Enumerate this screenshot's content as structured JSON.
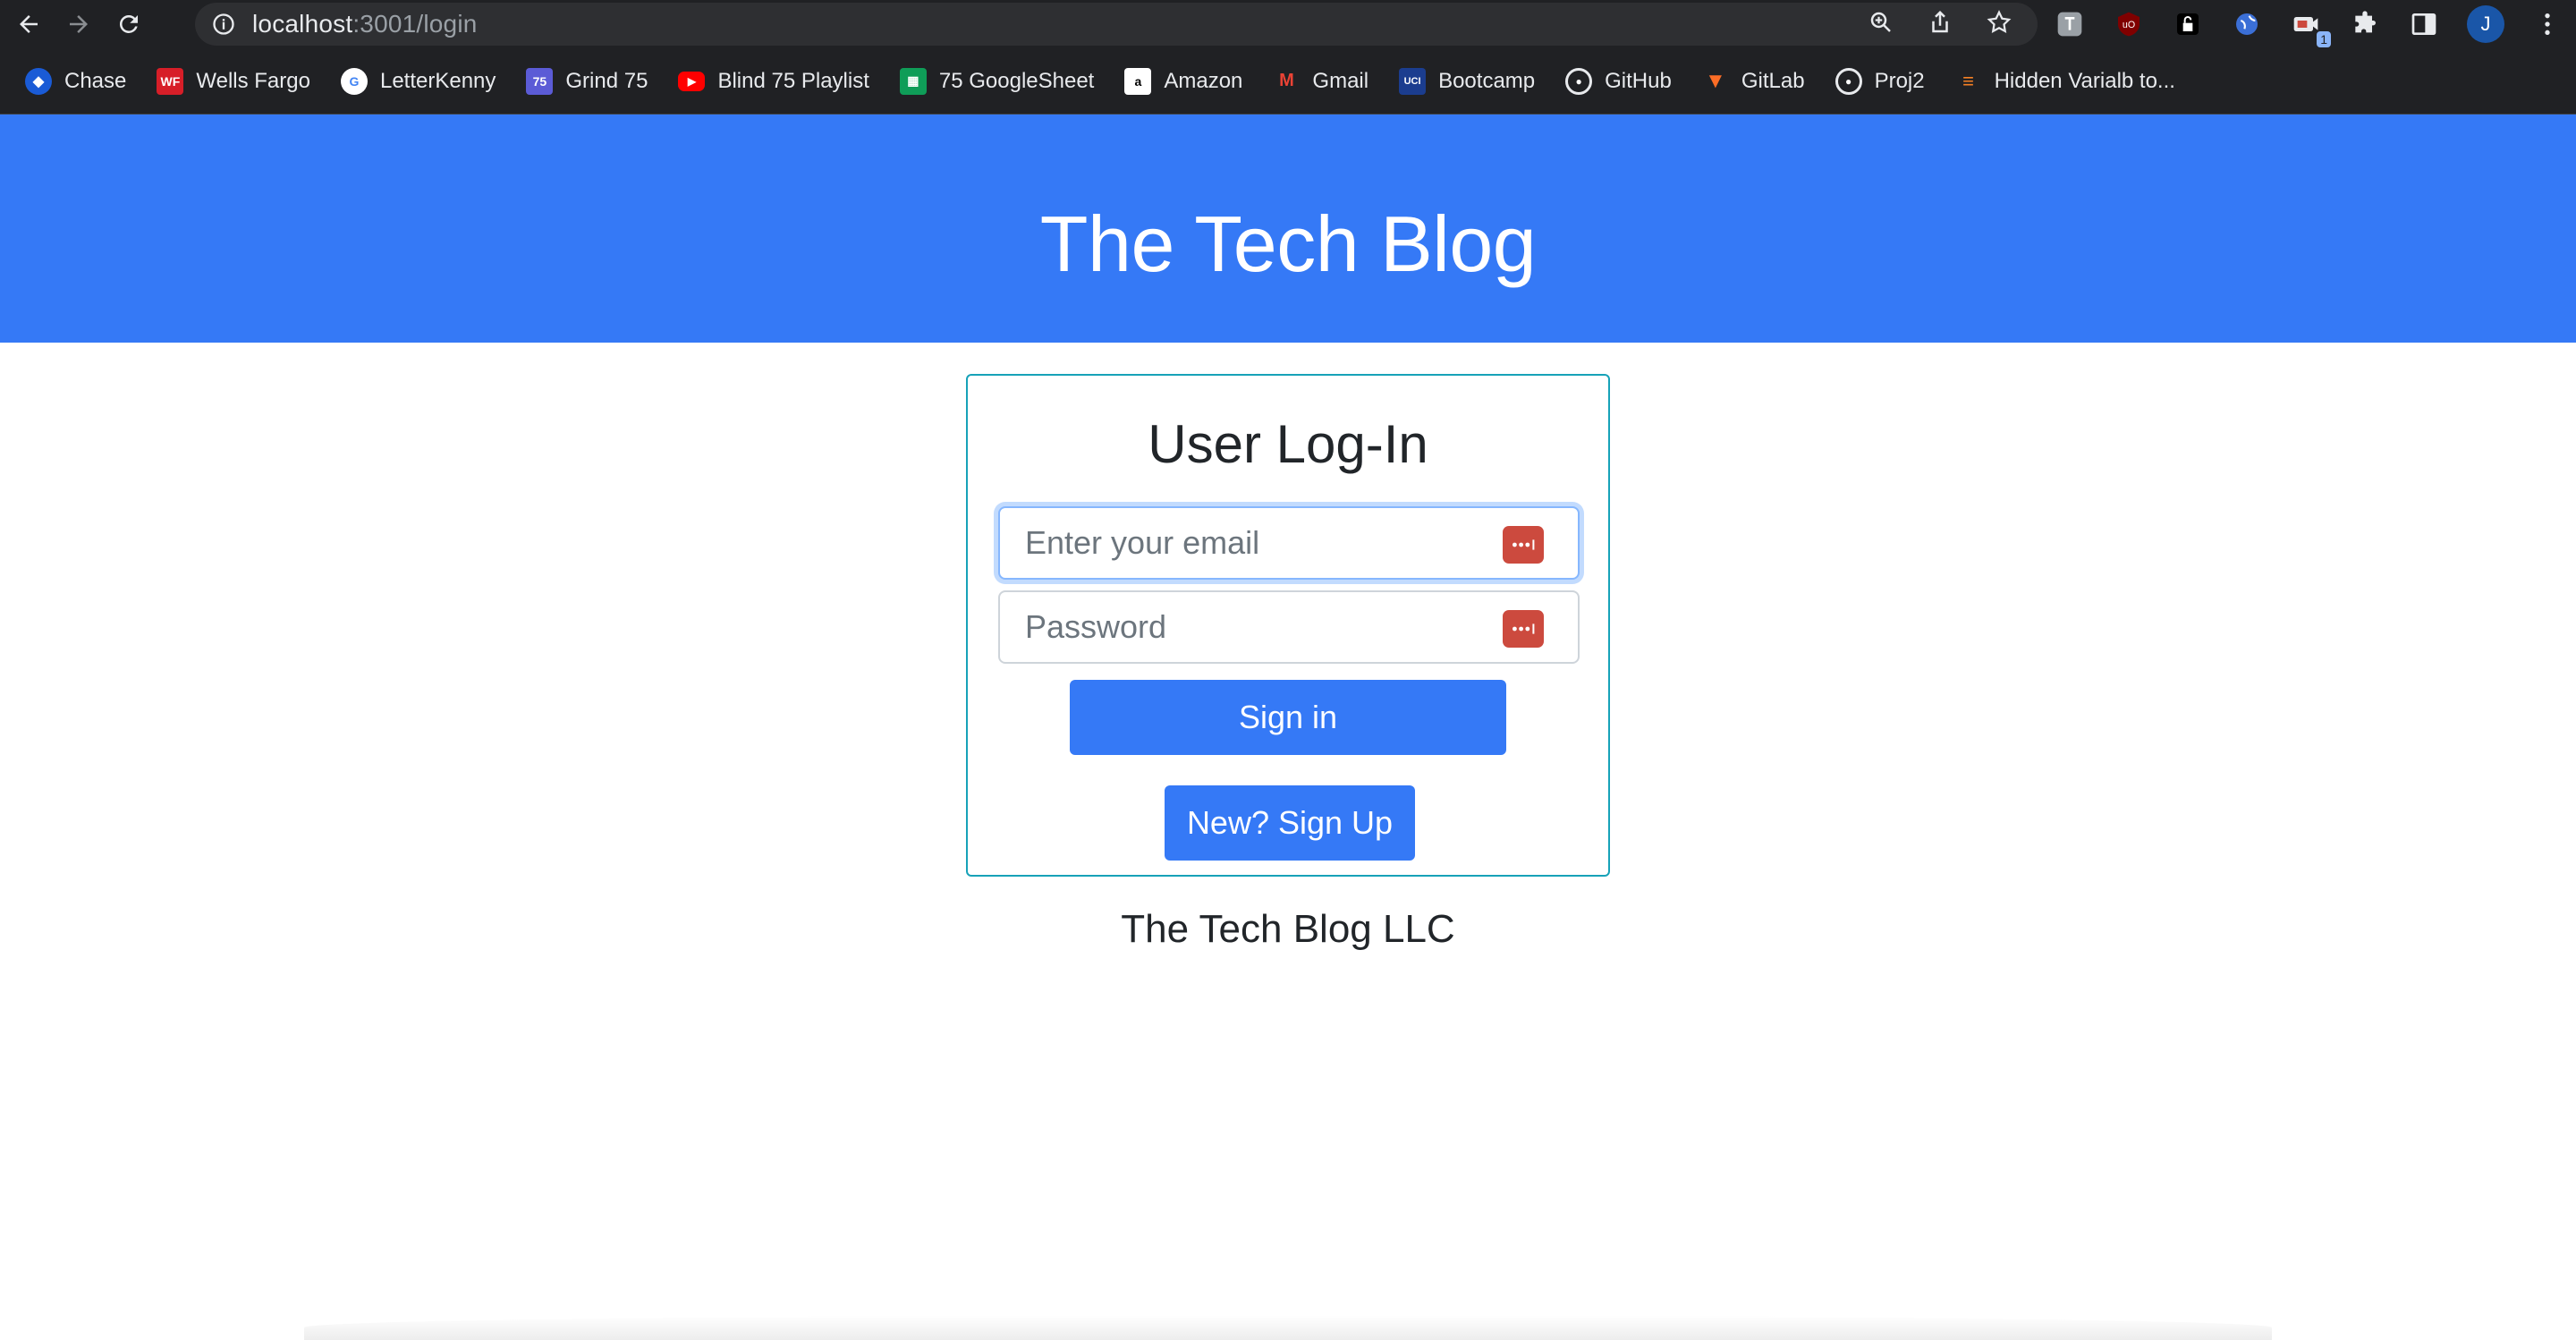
{
  "browser": {
    "url_host": "localhost",
    "url_path": ":3001/login",
    "profile_initial": "J",
    "extension_badge": "1"
  },
  "bookmarks": [
    {
      "label": "Chase",
      "icon": "chase-icon",
      "color": "#1a5bd6"
    },
    {
      "label": "Wells Fargo",
      "icon": "wells-fargo-icon",
      "color": "#d71e28"
    },
    {
      "label": "LetterKenny",
      "icon": "google-icon",
      "color": "#ffffff"
    },
    {
      "label": "Grind 75",
      "icon": "grind75-icon",
      "color": "#5b5bd6"
    },
    {
      "label": "Blind 75 Playlist",
      "icon": "youtube-icon",
      "color": "#ff0000"
    },
    {
      "label": "75 GoogleSheet",
      "icon": "sheets-icon",
      "color": "#0f9d58"
    },
    {
      "label": "Amazon",
      "icon": "amazon-icon",
      "color": "#ffffff"
    },
    {
      "label": "Gmail",
      "icon": "gmail-icon",
      "color": "#ea4335"
    },
    {
      "label": "Bootcamp",
      "icon": "uci-icon",
      "color": "#1b3d8f"
    },
    {
      "label": "GitHub",
      "icon": "github-icon",
      "color": "#ffffff"
    },
    {
      "label": "GitLab",
      "icon": "gitlab-icon",
      "color": "#fc6d26"
    },
    {
      "label": "Proj2",
      "icon": "github-icon",
      "color": "#ffffff"
    },
    {
      "label": "Hidden Varialb to...",
      "icon": "stackoverflow-icon",
      "color": "#f48024"
    }
  ],
  "header": {
    "title": "The Tech Blog"
  },
  "login": {
    "heading": "User Log-In",
    "email_placeholder": "Enter your email",
    "password_placeholder": "Password",
    "sign_in_label": "Sign in",
    "sign_up_label": "New? Sign Up"
  },
  "footer": {
    "text": "The Tech Blog LLC"
  },
  "colors": {
    "accent": "#3579f6",
    "card_border": "#17a2b8",
    "password_manager": "#cc4a3e"
  }
}
